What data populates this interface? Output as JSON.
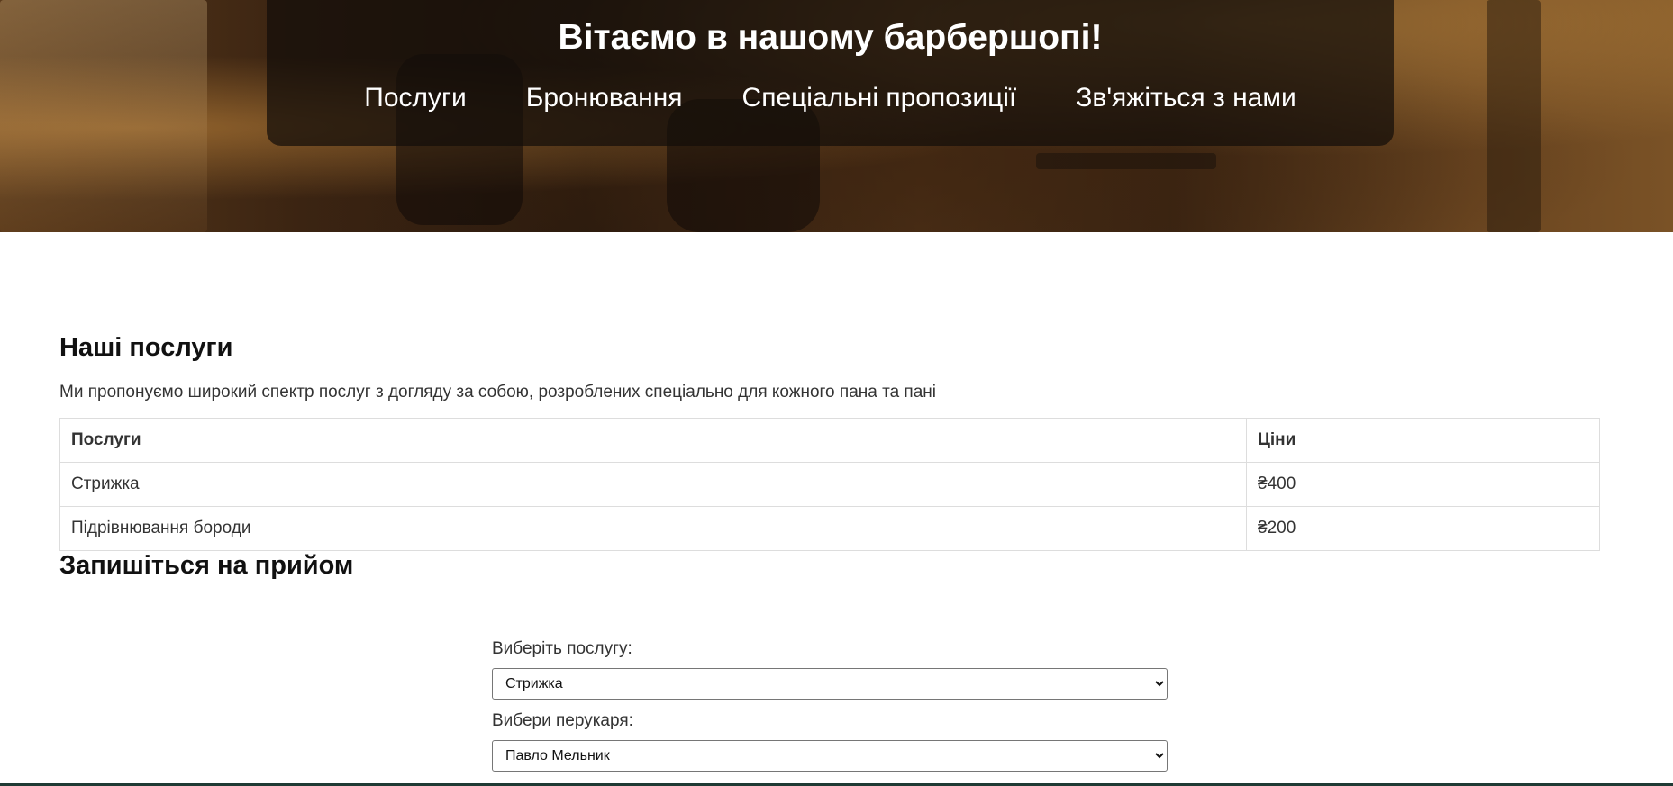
{
  "header": {
    "title": "Вітаємо в нашому барбершопі!",
    "nav": [
      {
        "label": "Послуги"
      },
      {
        "label": "Бронювання"
      },
      {
        "label": "Спеціальні пропозиції"
      },
      {
        "label": "Зв'яжіться з нами"
      }
    ]
  },
  "services": {
    "title": "Наші послуги",
    "description": "Ми пропонуємо широкий спектр послуг з догляду за собою, розроблених спеціально для кожного пана та пані",
    "table": {
      "headers": [
        "Послуги",
        "Ціни"
      ],
      "rows": [
        [
          "Стрижка",
          "₴400"
        ],
        [
          "Підрівнювання бороди",
          "₴200"
        ]
      ]
    }
  },
  "booking": {
    "title": "Запишіться на прийом",
    "service_label": "Виберіть послугу:",
    "service_value": "Стрижка",
    "barber_label": "Вибери перукаря:",
    "barber_value": "Павло Мельник"
  }
}
